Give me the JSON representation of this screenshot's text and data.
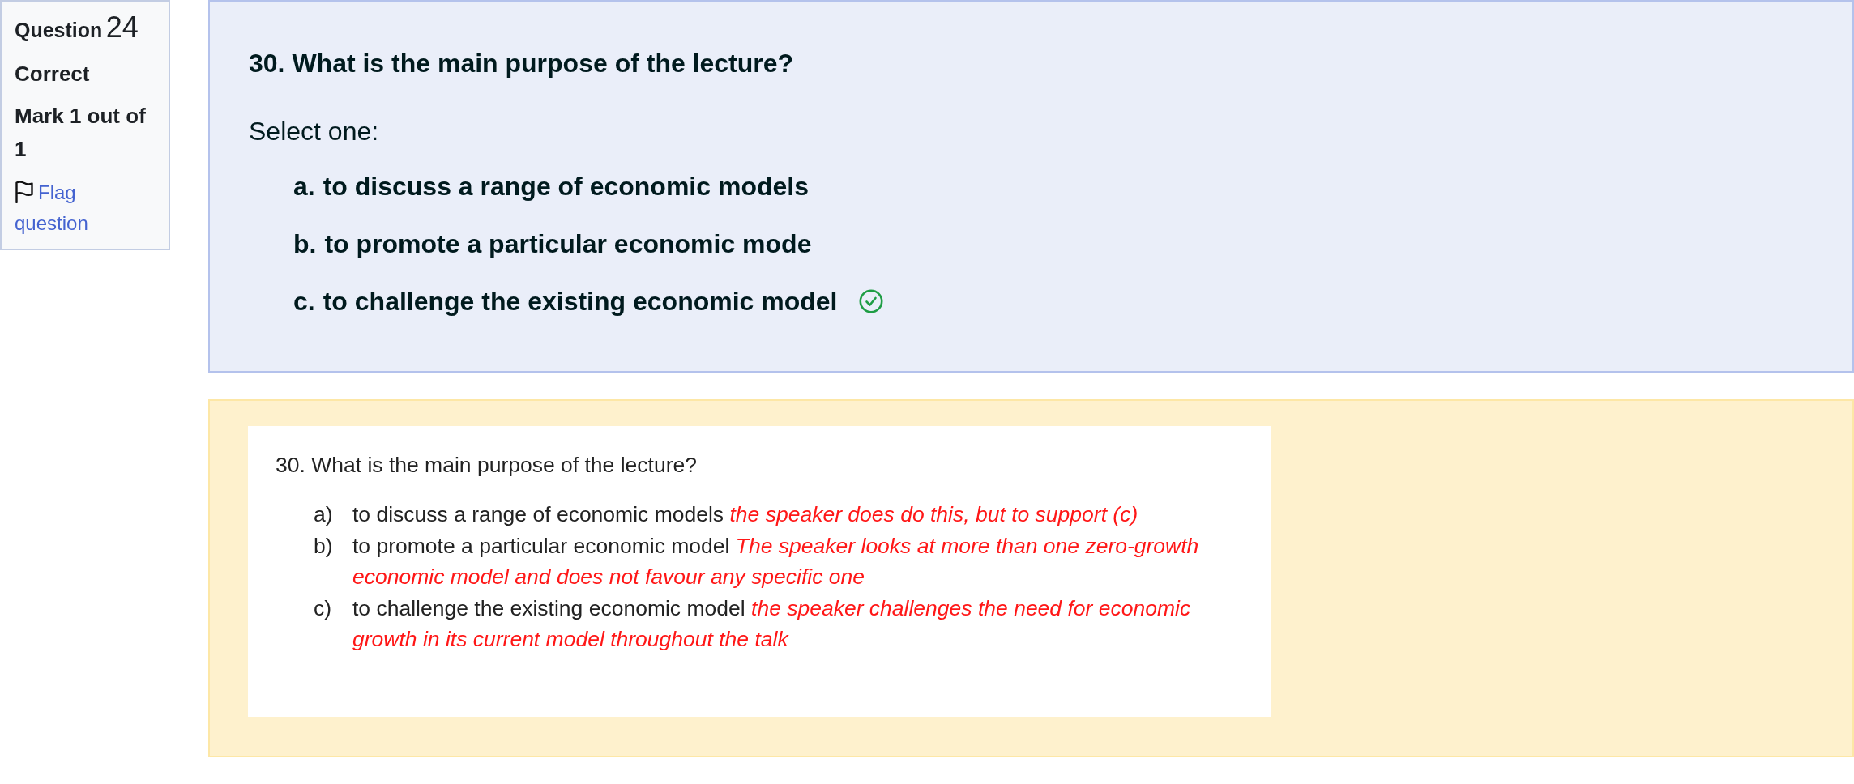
{
  "question_info": {
    "label": "Question",
    "number": "24",
    "state": "Correct",
    "grade": "Mark 1 out of 1",
    "flag_link": "Flag question"
  },
  "question": {
    "text": "30. What is the main purpose of the lecture?",
    "prompt": "Select one:",
    "options": [
      {
        "letter": "a.",
        "text": "to discuss a range of economic models",
        "correct": false
      },
      {
        "letter": "b.",
        "text": "to promote a particular economic mode",
        "correct": false
      },
      {
        "letter": "c.",
        "text": "to challenge the existing economic model",
        "correct": true
      }
    ]
  },
  "feedback": {
    "document": {
      "title": "30. What is the main purpose of the lecture?",
      "items": [
        {
          "marker": "a)",
          "option": "to discuss a range of economic models",
          "comment": "the speaker does do this, but to support (c)"
        },
        {
          "marker": "b)",
          "option": "to promote a particular economic model",
          "comment": "The speaker looks at more than one zero-growth economic model and does not favour any specific one"
        },
        {
          "marker": "c)",
          "option": "to challenge the existing economic model",
          "comment": "the speaker challenges the need for economic growth in its current model throughout the talk"
        }
      ]
    }
  }
}
